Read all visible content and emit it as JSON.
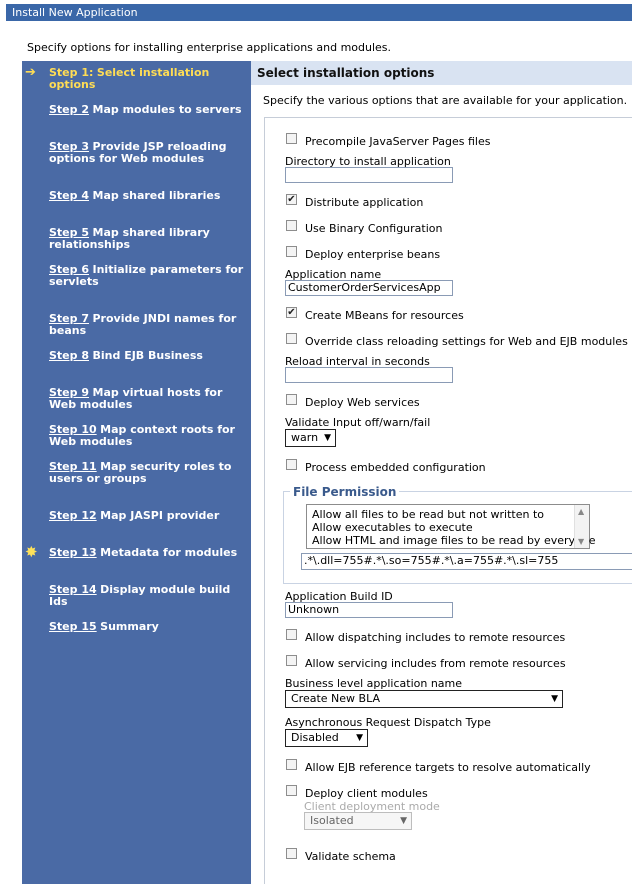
{
  "window_title": "Install New Application",
  "intro": "Specify options for installing enterprise applications and modules.",
  "steps": [
    {
      "num": "Step 1:",
      "text": "Select installation options",
      "current": true
    },
    {
      "num": "Step 2",
      "text": "Map modules to servers"
    },
    {
      "num": "Step 3",
      "text": "Provide JSP reloading options for Web modules"
    },
    {
      "num": "Step 4",
      "text": "Map shared libraries"
    },
    {
      "num": "Step 5",
      "text": "Map shared library relationships"
    },
    {
      "num": "Step 6",
      "text": "Initialize parameters for servlets"
    },
    {
      "num": "Step 7",
      "text": "Provide JNDI names for beans"
    },
    {
      "num": "Step 8",
      "text": "Bind EJB Business"
    },
    {
      "num": "Step 9",
      "text": "Map virtual hosts for Web modules"
    },
    {
      "num": "Step 10",
      "text": "Map context roots for Web modules"
    },
    {
      "num": "Step 11",
      "text": "Map security roles to users or groups"
    },
    {
      "num": "Step 12",
      "text": "Map JASPI provider"
    },
    {
      "num": "Step 13",
      "text": "Metadata for modules"
    },
    {
      "num": "Step 14",
      "text": "Display module build Ids"
    },
    {
      "num": "Step 15",
      "text": "Summary"
    }
  ],
  "main": {
    "header": "Select installation options",
    "description": "Specify the various options that are available for your application.",
    "precompile_jsp": {
      "label": "Precompile JavaServer Pages files",
      "checked": false
    },
    "install_dir": {
      "label": "Directory to install application",
      "value": ""
    },
    "distribute_app": {
      "label": "Distribute application",
      "checked": true
    },
    "binary_config": {
      "label": "Use Binary Configuration",
      "checked": false
    },
    "deploy_ejb": {
      "label": "Deploy enterprise beans",
      "checked": false
    },
    "app_name": {
      "label": "Application name",
      "value": "CustomerOrderServicesApp"
    },
    "create_mbeans": {
      "label": "Create MBeans for resources",
      "checked": true
    },
    "override_reload": {
      "label": "Override class reloading settings for Web and EJB modules",
      "checked": false
    },
    "reload_interval": {
      "label": "Reload interval in seconds",
      "value": ""
    },
    "deploy_ws": {
      "label": "Deploy Web services",
      "checked": false
    },
    "validate_input": {
      "label": "Validate Input off/warn/fail",
      "value": "warn"
    },
    "process_embedded": {
      "label": "Process embedded configuration",
      "checked": false
    },
    "file_permission": {
      "legend": "File Permission",
      "options": [
        "Allow all files to be read but not written to",
        "Allow executables to execute",
        "Allow HTML and image files to be read by everyone"
      ],
      "value": ".*\\.dll=755#.*\\.so=755#.*\\.a=755#.*\\.sl=755"
    },
    "build_id": {
      "label": "Application Build ID",
      "value": "Unknown"
    },
    "allow_dispatch": {
      "label": "Allow dispatching includes to remote resources",
      "checked": false
    },
    "allow_servicing": {
      "label": "Allow servicing includes from remote resources",
      "checked": false
    },
    "bla_name": {
      "label": "Business level application name",
      "value": "Create New BLA"
    },
    "async_dispatch": {
      "label": "Asynchronous Request Dispatch Type",
      "value": "Disabled"
    },
    "allow_ejb_ref": {
      "label": "Allow EJB reference targets to resolve automatically",
      "checked": false
    },
    "deploy_client": {
      "label": "Deploy client modules",
      "checked": false
    },
    "client_mode": {
      "label": "Client deployment mode",
      "value": "Isolated"
    },
    "validate_schema": {
      "label": "Validate schema",
      "checked": false
    }
  }
}
